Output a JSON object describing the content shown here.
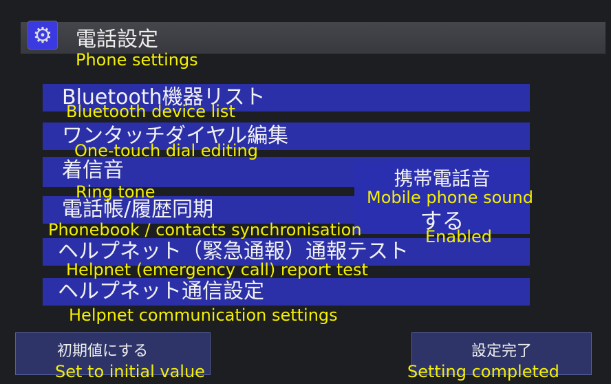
{
  "header": {
    "icon": "gear-icon",
    "title": "電話設定",
    "title_en": "Phone settings"
  },
  "menu": [
    {
      "label": "Bluetooth機器リスト",
      "en": "Bluetooth device list"
    },
    {
      "label": "ワンタッチダイヤル編集",
      "en": "One-touch dial editing"
    },
    {
      "label": "着信音",
      "en": "Ring tone"
    },
    {
      "label": "電話帳/履歴同期",
      "en": "Phonebook / contacts synchronisation"
    },
    {
      "label": "ヘルプネット（緊急通報）通報テスト",
      "en": "Helpnet (emergency call) report test"
    },
    {
      "label": "ヘルプネット通信設定",
      "en": "Helpnet communication settings"
    }
  ],
  "detail": {
    "title": "携帯電話音",
    "title_en": "Mobile phone sound",
    "value": "する",
    "value_en": "Enabled"
  },
  "buttons": {
    "reset": "初期値にする",
    "reset_en": "Set to initial value",
    "done": "設定完了",
    "done_en": "Setting completed"
  },
  "colors": {
    "accent": "#2b30a8",
    "annotation": "#f5f000"
  }
}
